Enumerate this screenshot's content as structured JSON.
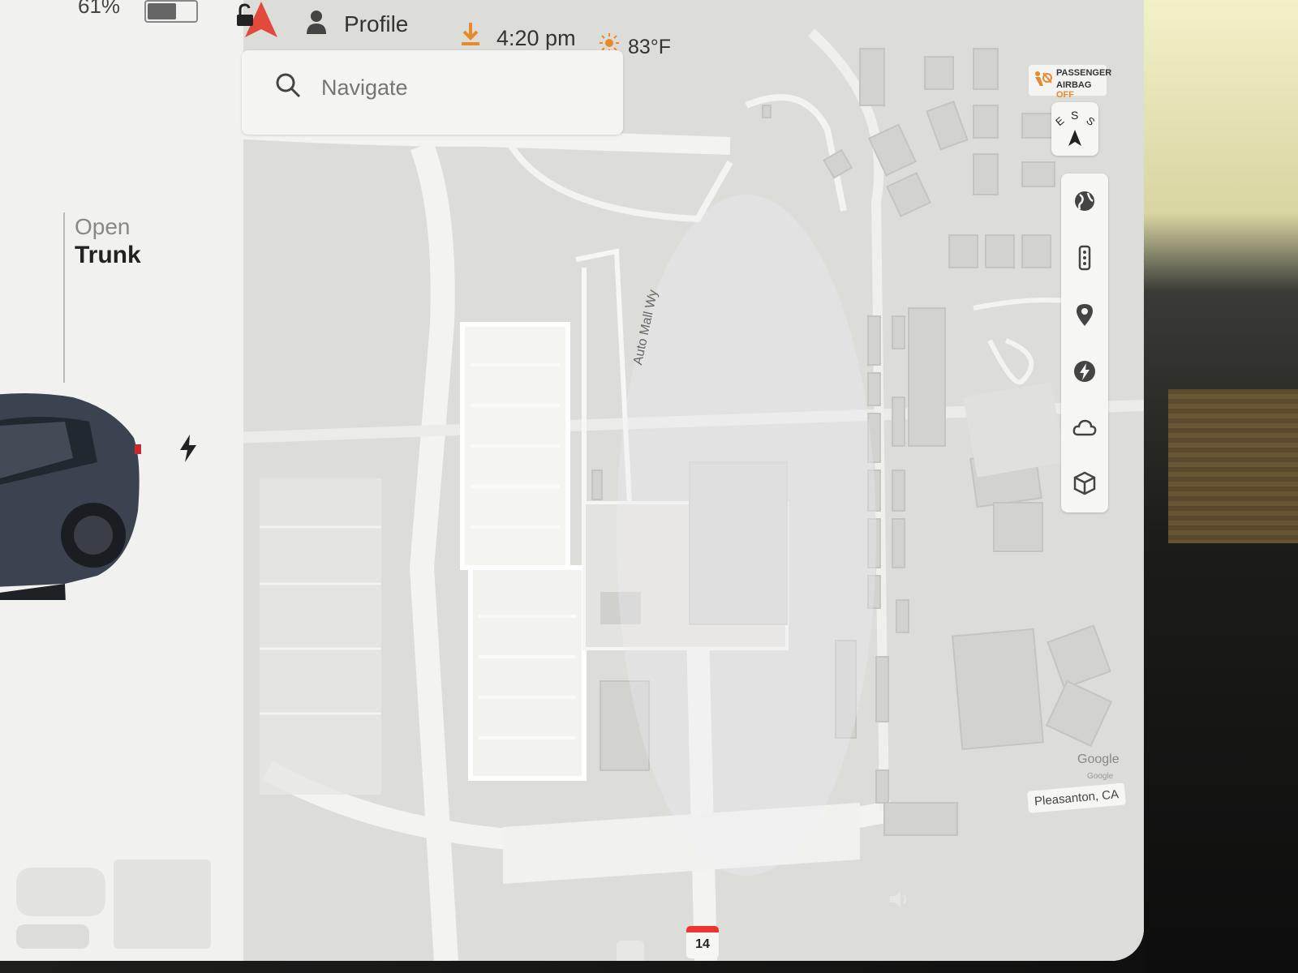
{
  "status_bar": {
    "battery_percent": "61%",
    "battery_level": 0.61,
    "profile_label": "Profile",
    "time": "4:20 pm",
    "temperature": "83°F"
  },
  "left_panel": {
    "trunk_open": "Open",
    "trunk_label": "Trunk"
  },
  "search": {
    "placeholder": "Navigate"
  },
  "airbag": {
    "line1": "PASSENGER",
    "line2_prefix": "AIRBAG",
    "line2_status": "OFF"
  },
  "compass": {
    "w": "E",
    "s": "S",
    "e": "S"
  },
  "map": {
    "street_name": "Auto Mall Wy",
    "attribution_1": "Google",
    "attribution_2": "Google",
    "location": "Pleasanton, CA"
  },
  "toolbar": {
    "icons": [
      "globe-icon",
      "traffic-icon",
      "pin-icon",
      "bolt-icon",
      "cloud-icon",
      "cube-icon"
    ]
  },
  "dock": {
    "calendar_day": "14"
  },
  "colors": {
    "accent_orange": "#e8892b",
    "nav_arrow": "#e24a3d",
    "calendar_red": "#e33333"
  }
}
